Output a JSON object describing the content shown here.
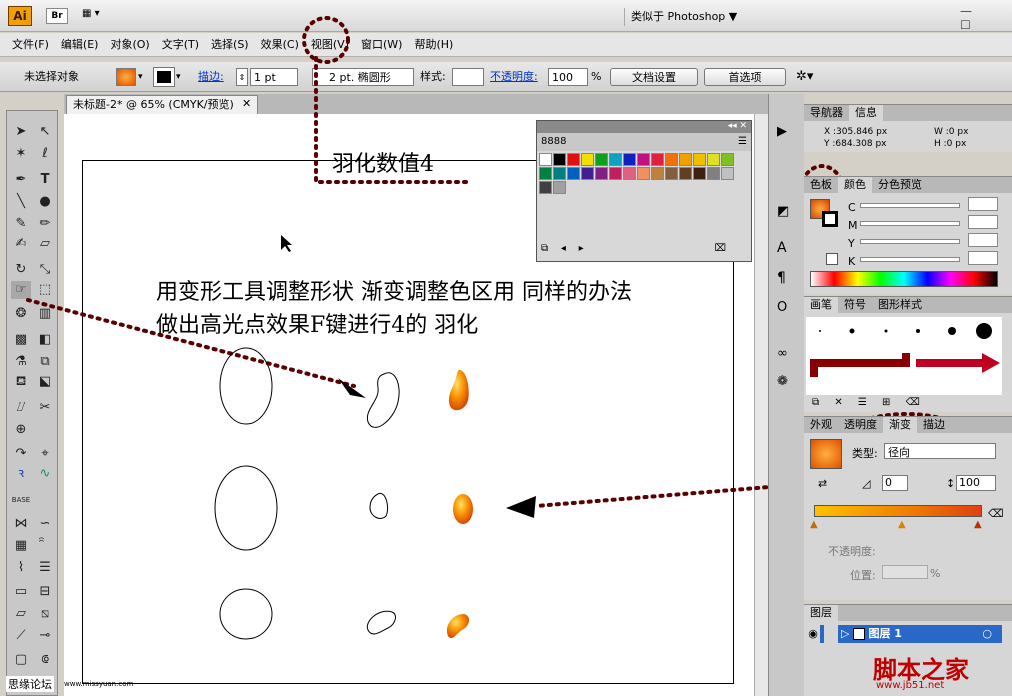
{
  "app": {
    "logo": "Ai",
    "bridge": "Br",
    "layout_icon": "layout-icon",
    "workspace": "类似于 Photoshop ▼",
    "win_controls": "— ☐"
  },
  "menu": [
    "文件(F)",
    "编辑(E)",
    "对象(O)",
    "文字(T)",
    "选择(S)",
    "效果(C)",
    "视图(V)",
    "窗口(W)",
    "帮助(H)"
  ],
  "control": {
    "selection": "未选择对象",
    "stroke_label": "描边:",
    "stroke_weight": "1 pt",
    "brush": "2 pt. 椭圆形",
    "style_label": "样式:",
    "opacity_label": "不透明度:",
    "opacity_value": "100",
    "percent": "%",
    "doc_setup": "文档设置",
    "prefs": "首选项"
  },
  "doc_tab": {
    "title": "未标题-2* @ 65% (CMYK/预览)",
    "close": "✕"
  },
  "annotations": {
    "feather": "羽化数值4",
    "steps": "用变形工具调整形状 渐变调整色区用 同样的办法做出高光点效果F键进行4的 羽化"
  },
  "swatch_panel": {
    "title": "8888",
    "colors": [
      "#ffffff",
      "#000000",
      "#e01010",
      "#f0e000",
      "#10a020",
      "#10a0c0",
      "#1020c0",
      "#c01080",
      "#e02040",
      "#f07010",
      "#f0a000",
      "#f0c000",
      "#e0e020",
      "#80c020",
      "#008040",
      "#008080",
      "#0060c0",
      "#402090",
      "#802080",
      "#c02060",
      "#e06080",
      "#f09060",
      "#c08040",
      "#806040",
      "#604020",
      "#402010",
      "#808080",
      "#c0c0c0",
      "#404040",
      "#a0a0a0"
    ]
  },
  "navigator": {
    "tab1": "导航器",
    "tab2": "信息",
    "x": "X :305.846 px",
    "y": "Y :684.308 px",
    "w": "W :0 px",
    "h": "H :0 px"
  },
  "color_panel": {
    "tab1": "色板",
    "tab2": "颜色",
    "tab3": "分色预览",
    "channels": [
      "C",
      "M",
      "Y",
      "K"
    ]
  },
  "brush_panel": {
    "tab1": "画笔",
    "tab2": "符号",
    "tab3": "图形样式"
  },
  "gradient_panel": {
    "tab1": "外观",
    "tab2": "透明度",
    "tab3": "渐变",
    "tab4": "描边",
    "type_label": "类型:",
    "type_value": "径向",
    "angle": "0",
    "ratio": "100",
    "opacity_label": "不透明度:",
    "location_label": "位置:",
    "percent": "%"
  },
  "layers_panel": {
    "tab": "图层",
    "layer1": "图层 1"
  },
  "footer": {
    "site": "思缘论坛",
    "site_url": "www.missyuan.com",
    "logo": "脚本之家",
    "url": "www.jb51.net"
  },
  "colors": {
    "accent": "#f08000",
    "dots": "#5a0000"
  }
}
